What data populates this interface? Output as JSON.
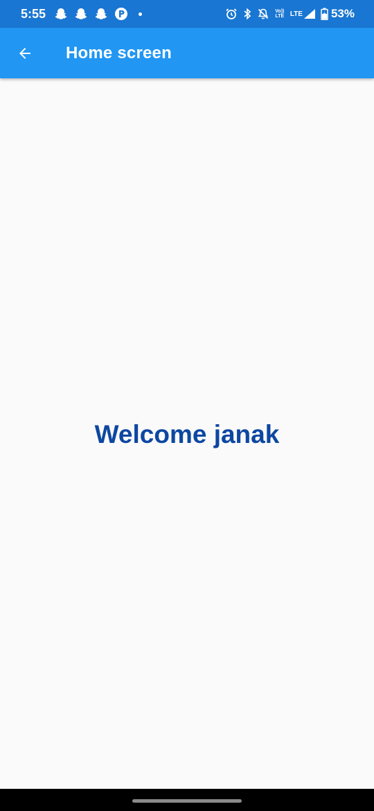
{
  "status_bar": {
    "time": "5:55",
    "left_icons": [
      "snapchat-icon",
      "snapchat-icon",
      "snapchat-icon",
      "app-notification-icon"
    ],
    "lte_small": "Vo)) LTE",
    "lte_label": "LTE",
    "battery_percent": "53%",
    "background": "#1976d2"
  },
  "app_bar": {
    "title": "Home screen",
    "background": "#2196f3"
  },
  "main": {
    "welcome_text": "Welcome janak",
    "text_color": "#0d47a1"
  }
}
